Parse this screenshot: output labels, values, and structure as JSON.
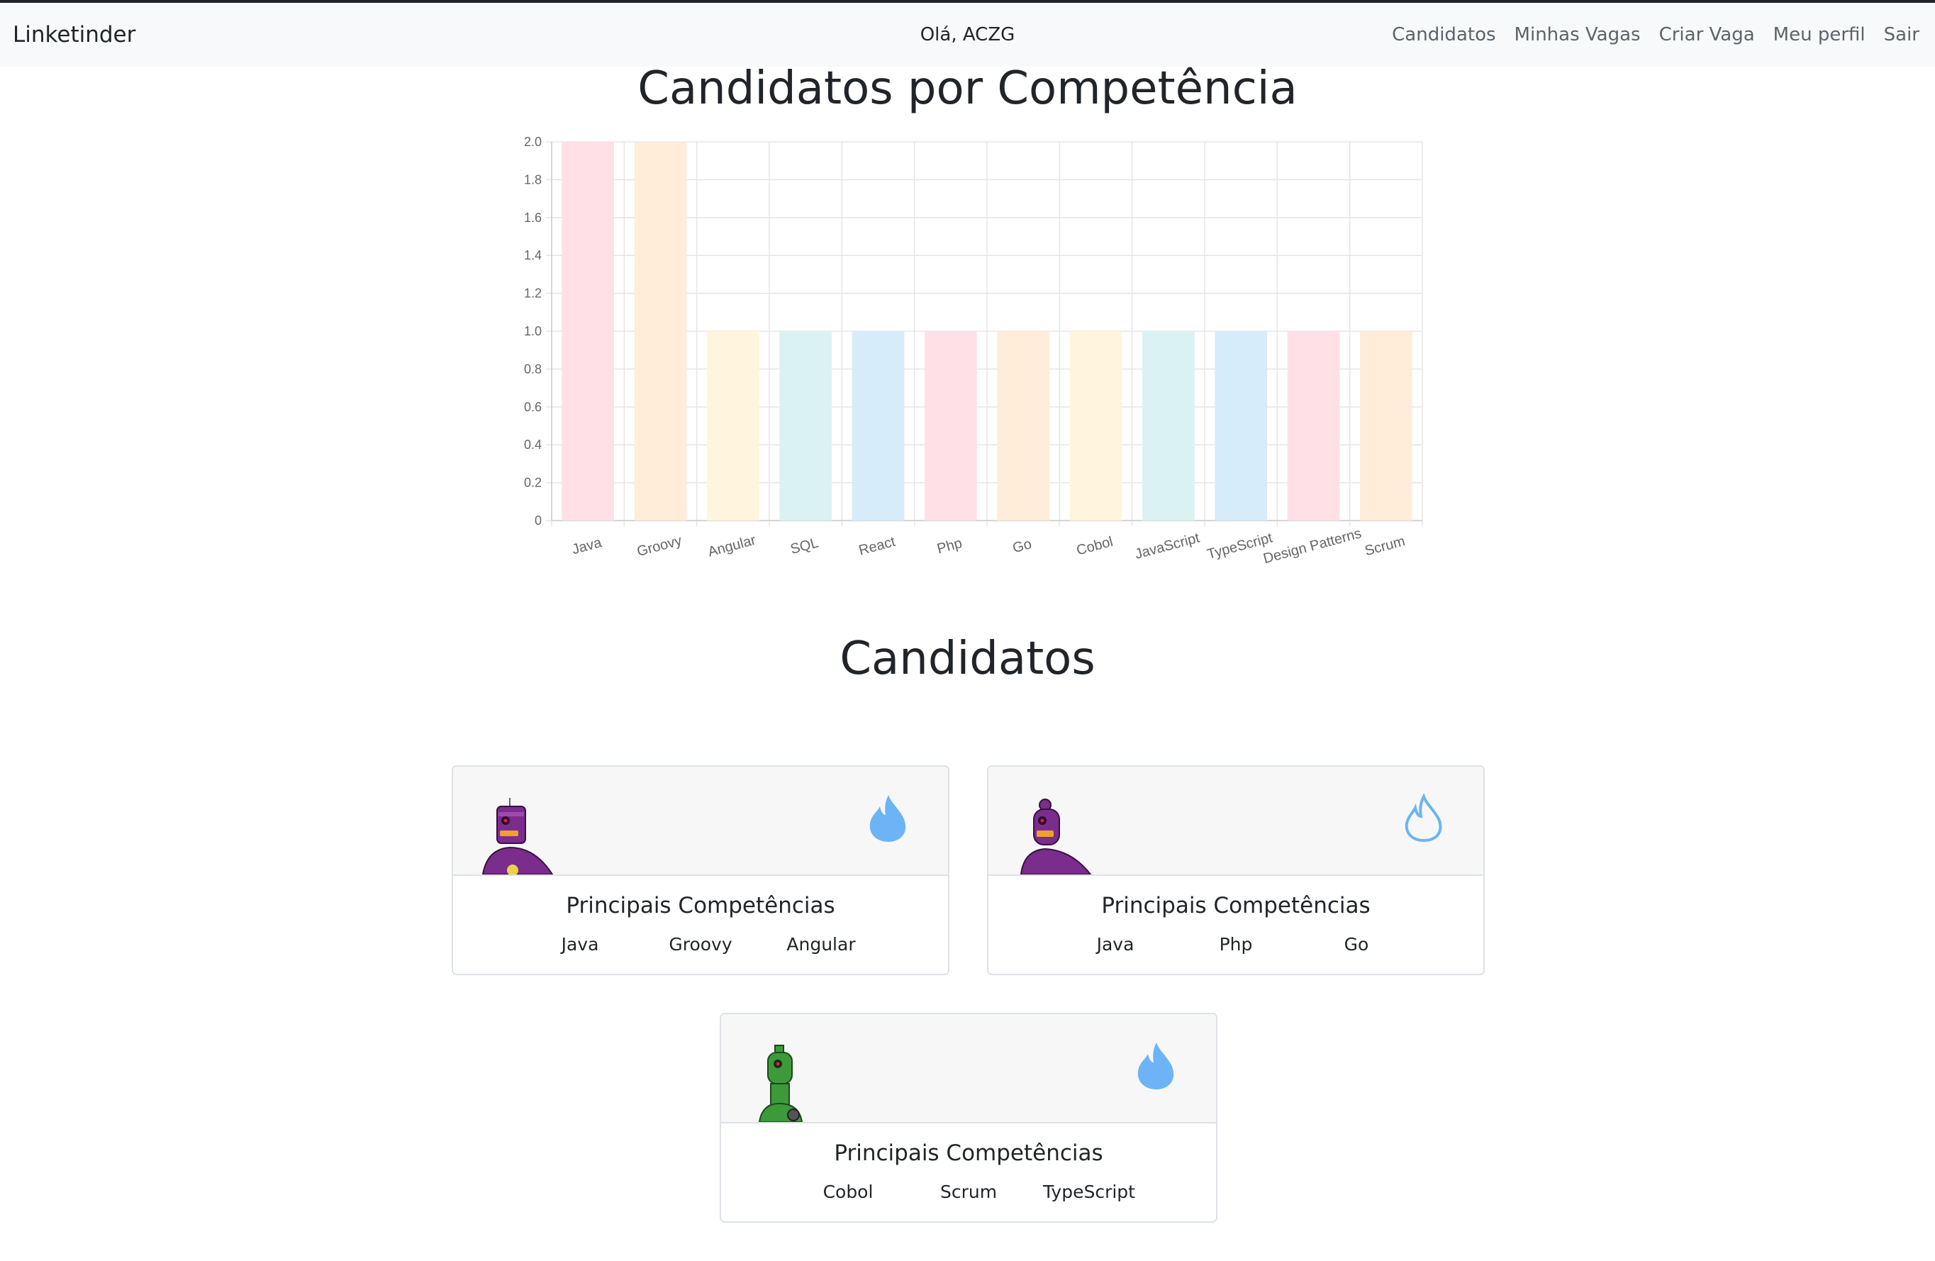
{
  "navbar": {
    "brand": "Linketinder",
    "greeting": "Olá, ACZG",
    "links": [
      "Candidatos",
      "Minhas Vagas",
      "Criar Vaga",
      "Meu perfil",
      "Sair"
    ]
  },
  "chart_title": "Candidatos por Competência",
  "chart_data": {
    "type": "bar",
    "categories": [
      "Java",
      "Groovy",
      "Angular",
      "SQL",
      "React",
      "Php",
      "Go",
      "Cobol",
      "JavaScript",
      "TypeScript",
      "Design Patterns",
      "Scrum"
    ],
    "values": [
      2,
      2,
      1,
      1,
      1,
      1,
      1,
      1,
      1,
      1,
      1,
      1
    ],
    "ylim": [
      0,
      2
    ],
    "yticks": [
      "0",
      "0.2",
      "0.4",
      "0.6",
      "0.8",
      "1.0",
      "1.2",
      "1.4",
      "1.6",
      "1.8",
      "2.0"
    ],
    "grid": true,
    "bar_colors": [
      "#ffe0e6",
      "#ffecd9",
      "#fff5dd",
      "#dbf2f2",
      "#d7ecfb",
      "#ffe0e6",
      "#ffecd9",
      "#fff5dd",
      "#dbf2f2",
      "#d7ecfb",
      "#ffe0e6",
      "#ffecd9"
    ]
  },
  "section_title": "Candidatos",
  "cards": [
    {
      "robot": "purple-robot-icon",
      "flame": "filled",
      "title": "Principais Competências",
      "skills": [
        "Java",
        "Groovy",
        "Angular"
      ]
    },
    {
      "robot": "purple-robot-icon",
      "flame": "outline",
      "title": "Principais Competências",
      "skills": [
        "Java",
        "Php",
        "Go"
      ]
    },
    {
      "robot": "green-robot-icon",
      "flame": "filled",
      "title": "Principais Competências",
      "skills": [
        "Cobol",
        "Scrum",
        "TypeScript"
      ]
    }
  ],
  "colors": {
    "flame": "#6cb4f5",
    "navbar_bg": "#f8f9fa",
    "purple": "#7a2d8c",
    "green": "#3c9a3a"
  }
}
